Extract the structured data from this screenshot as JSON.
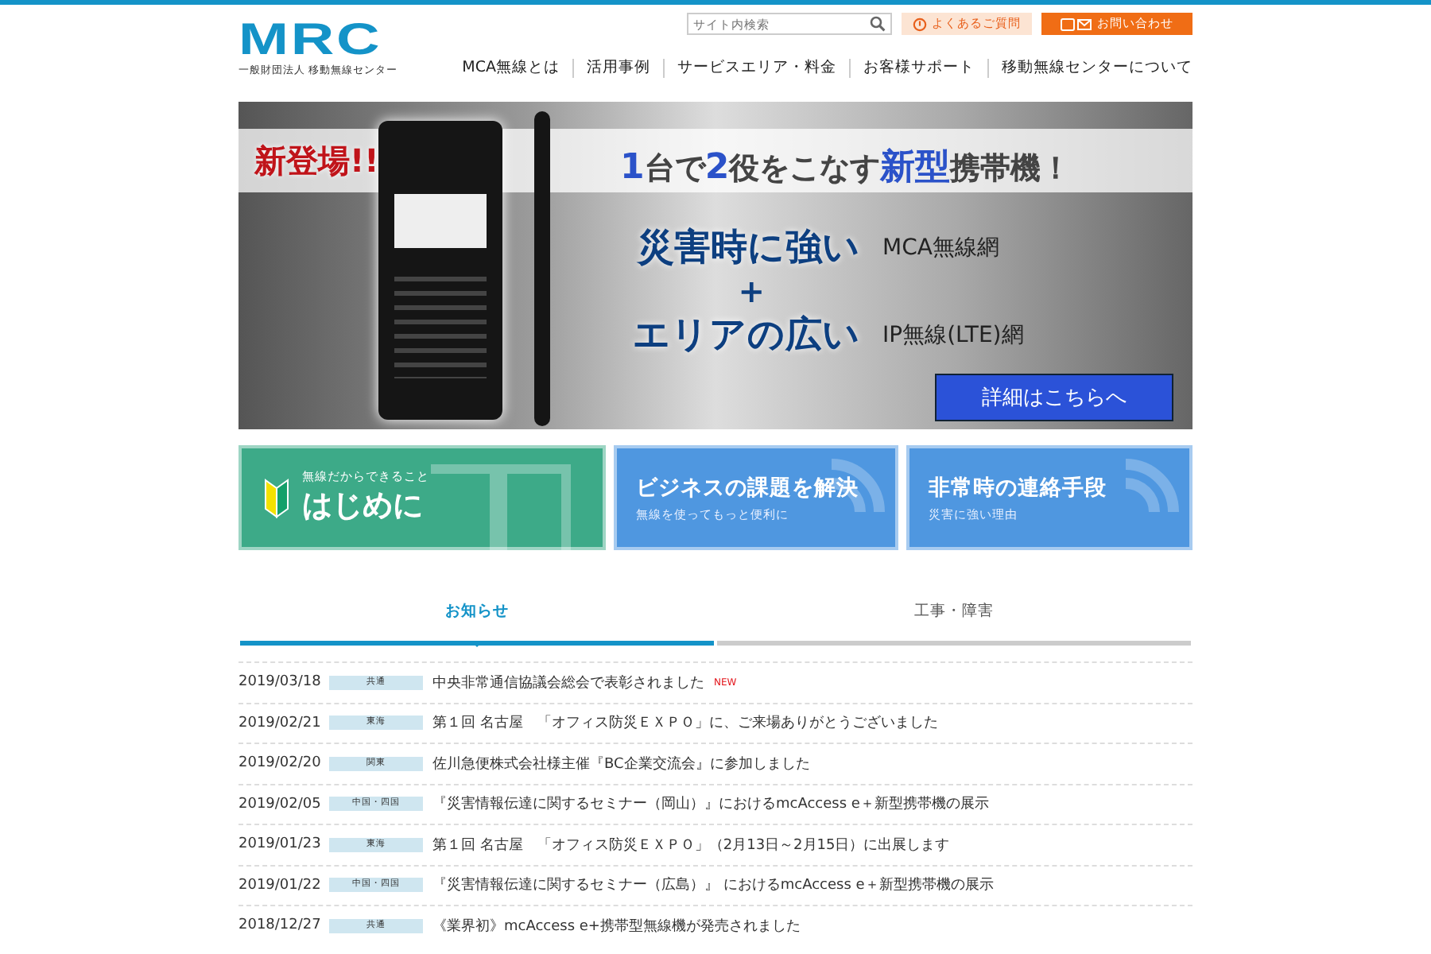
{
  "header": {
    "logo": "MRC",
    "logo_subtitle": "一般財団法人 移動無線センター",
    "search": {
      "placeholder": "サイト内検索"
    },
    "faq_button": "よくあるご質問",
    "contact_button": "お問い合わせ"
  },
  "nav": [
    "MCA無線とは",
    "活用事例",
    "サービスエリア・料金",
    "お客様サポート",
    "移動無線センターについて"
  ],
  "banner": {
    "badge": "新登場!!",
    "headline": "**1**台で**2**役をこなす**新型**携帯機！",
    "line_1": "災害時に強い",
    "network_1": "MCA無線網",
    "plus": "+",
    "line_2": "エリアの広い",
    "network_2": "IP無線(LTE)網",
    "button": "詳細はこちらへ"
  },
  "cards": [
    {
      "kind": "beginner",
      "eyebrow": "無線だからできること",
      "title": "はじめに"
    },
    {
      "kind": "signal",
      "title": "ビジネスの課題を解決",
      "subtitle": "無線を使ってもっと便利に"
    },
    {
      "kind": "signal",
      "title": "非常時の連絡手段",
      "subtitle": "災害に強い理由"
    }
  ],
  "tabs": [
    {
      "label": "お知らせ",
      "selected": true
    },
    {
      "label": "工事・障害",
      "selected": false
    }
  ],
  "news": [
    {
      "date": "2019/03/18",
      "region": "共通",
      "title": "中央非常通信協議会総会で表彰されました",
      "new": "NEW"
    },
    {
      "date": "2019/02/21",
      "region": "東海",
      "title": "第１回 名古屋　「オフィス防災ＥＸＰＯ」に、ご来場ありがとうございました"
    },
    {
      "date": "2019/02/20",
      "region": "関東",
      "title": "佐川急便株式会社様主催『BC企業交流会』に参加しました"
    },
    {
      "date": "2019/02/05",
      "region": "中国・四国",
      "title": "『災害情報伝達に関するセミナー（岡山）』におけるmcAccess e＋新型携帯機の展示"
    },
    {
      "date": "2019/01/23",
      "region": "東海",
      "title": "第１回 名古屋　「オフィス防災ＥＸＰＯ」（2月13日～2月15日）に出展します"
    },
    {
      "date": "2019/01/22",
      "region": "中国・四国",
      "title": "『災害情報伝達に関するセミナー（広島）』 におけるmcAccess e＋新型携帯機の展示"
    },
    {
      "date": "2018/12/27",
      "region": "共通",
      "title": "《業界初》mcAccess e+携帯型無線機が発売されました"
    }
  ]
}
